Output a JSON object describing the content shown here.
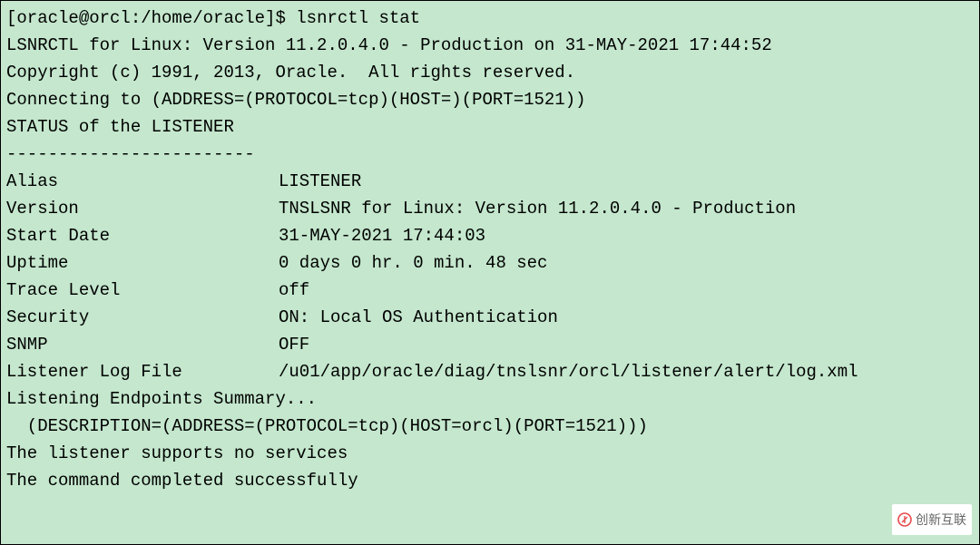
{
  "prompt": "[oracle@orcl:/home/oracle]$ ",
  "command": "lsnrctl stat",
  "blank": "",
  "banner_line": "LSNRCTL for Linux: Version 11.2.0.4.0 - Production on 31-MAY-2021 17:44:52",
  "copyright_line": "Copyright (c) 1991, 2013, Oracle.  All rights reserved.",
  "connecting_line": "Connecting to (ADDRESS=(PROTOCOL=tcp)(HOST=)(PORT=1521))",
  "status_header": "STATUS of the LISTENER",
  "divider": "------------------------",
  "fields": {
    "alias": {
      "label": "Alias",
      "value": "LISTENER"
    },
    "version": {
      "label": "Version",
      "value": "TNSLSNR for Linux: Version 11.2.0.4.0 - Production"
    },
    "start_date": {
      "label": "Start Date",
      "value": "31-MAY-2021 17:44:03"
    },
    "uptime": {
      "label": "Uptime",
      "value": "0 days 0 hr. 0 min. 48 sec"
    },
    "trace": {
      "label": "Trace Level",
      "value": "off"
    },
    "security": {
      "label": "Security",
      "value": "ON: Local OS Authentication"
    },
    "snmp": {
      "label": "SNMP",
      "value": "OFF"
    },
    "log_file": {
      "label": "Listener Log File",
      "value": "/u01/app/oracle/diag/tnslsnr/orcl/listener/alert/log.xml"
    }
  },
  "endpoints_header": "Listening Endpoints Summary...",
  "endpoints_desc": "  (DESCRIPTION=(ADDRESS=(PROTOCOL=tcp)(HOST=orcl)(PORT=1521)))",
  "no_services": "The listener supports no services",
  "completed": "The command completed successfully",
  "watermark_text": "创新互联"
}
